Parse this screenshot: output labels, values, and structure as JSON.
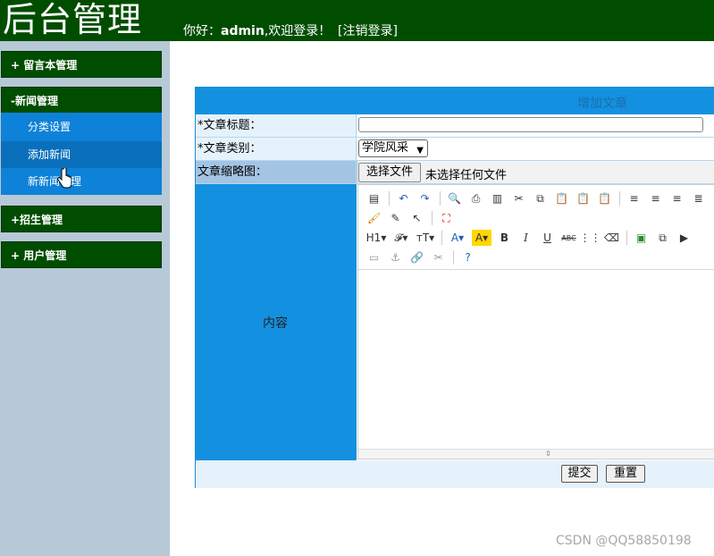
{
  "header": {
    "brand": "后台管理",
    "greeting_prefix": "你好：",
    "username": "admin",
    "greeting_suffix": ",欢迎登录！",
    "logout": "[注销登录]"
  },
  "sidebar": {
    "menus": [
      {
        "label": "+ 留言本管理"
      },
      {
        "label": "-新闻管理"
      },
      {
        "label": "+招生管理"
      },
      {
        "label": "+ 用户管理"
      }
    ],
    "news_sub": [
      {
        "label": "分类设置"
      },
      {
        "label": "添加新闻"
      },
      {
        "label": "新新闻管理"
      }
    ]
  },
  "form": {
    "title": "增加文章",
    "title_label": "*文章标题：",
    "title_value": "",
    "category_label": "*文章类别：",
    "category_value": "学院风采",
    "thumb_label": "文章缩略图：",
    "file_button": "选择文件",
    "file_status": "未选择任何文件",
    "content_label": "内容",
    "submit": "提交",
    "reset": "重置"
  },
  "editor_icons": [
    [
      "source-icon",
      "undo-icon",
      "redo-icon",
      "preview-icon",
      "print-icon",
      "template-icon",
      "cut-icon",
      "copy-icon",
      "paste-icon",
      "paste-text-icon",
      "paste-word-icon",
      "align-left-icon",
      "align-center-icon",
      "align-right-icon",
      "justify-icon"
    ],
    [
      "clear-format-icon",
      "select-all-icon",
      "cursor-icon",
      "fullscreen-icon"
    ],
    [
      "heading-icon",
      "font-family-icon",
      "font-size-icon",
      "font-color-icon",
      "highlight-icon",
      "bold-icon",
      "italic-icon",
      "underline-icon",
      "strikethrough-icon",
      "line-height-icon",
      "eraser-icon",
      "image-icon",
      "multi-image-icon",
      "flash-icon"
    ],
    [
      "page-break-icon",
      "anchor-icon",
      "link-icon",
      "unlink-icon",
      "help-icon"
    ]
  ],
  "watermark": "CSDN @QQ58850198"
}
